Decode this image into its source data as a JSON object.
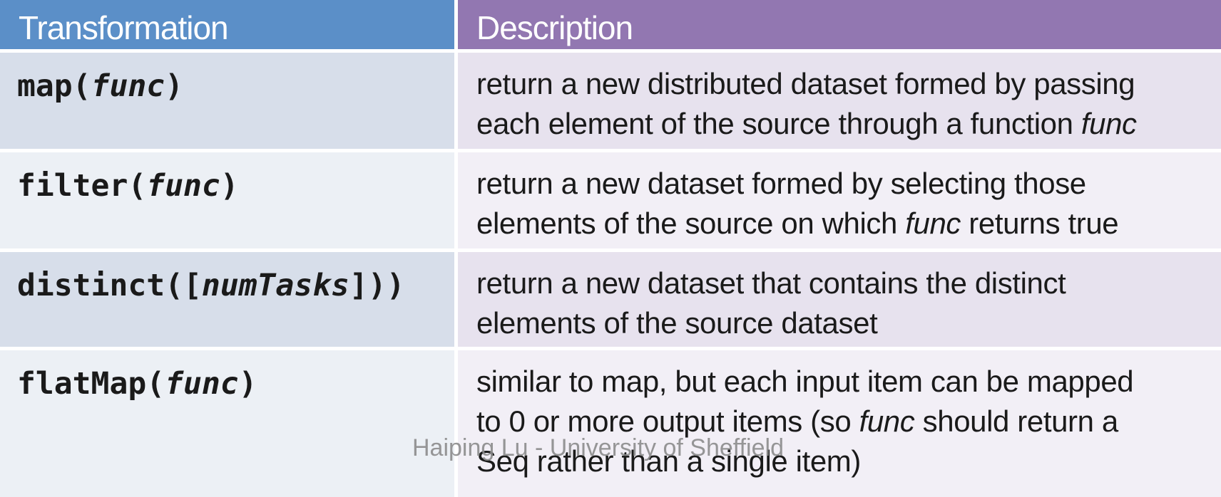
{
  "header": {
    "col1": "Transformation",
    "col2": "Description"
  },
  "rows": [
    {
      "fn_name": "map(",
      "fn_arg": "func",
      "fn_close": ")",
      "desc_line1": "return a new distributed dataset formed by passing",
      "desc_line2_pre": "each element of the source through a function ",
      "desc_line2_it": "func",
      "desc_line2_post": ""
    },
    {
      "fn_name": "filter(",
      "fn_arg": "func",
      "fn_close": ")",
      "desc_line1": "return a new dataset formed by selecting those",
      "desc_line2_pre": "elements of the source on which ",
      "desc_line2_it": "func",
      "desc_line2_post": " returns true"
    },
    {
      "fn_name": "distinct([",
      "fn_arg": "numTasks",
      "fn_close": "]))",
      "desc_line1": "return a new dataset that contains the distinct",
      "desc_line2_pre": "elements of the source dataset",
      "desc_line2_it": "",
      "desc_line2_post": ""
    },
    {
      "fn_name": "flatMap(",
      "fn_arg": "func",
      "fn_close": ")",
      "desc_line1": "similar to map, but each input item can be mapped",
      "desc_line2_pre": "to 0 or more output items (so ",
      "desc_line2_it": "func",
      "desc_line2_post": " should return a",
      "desc_line3": "Seq rather than a single item)"
    }
  ],
  "watermark": "Haiping Lu - University of Sheffield"
}
